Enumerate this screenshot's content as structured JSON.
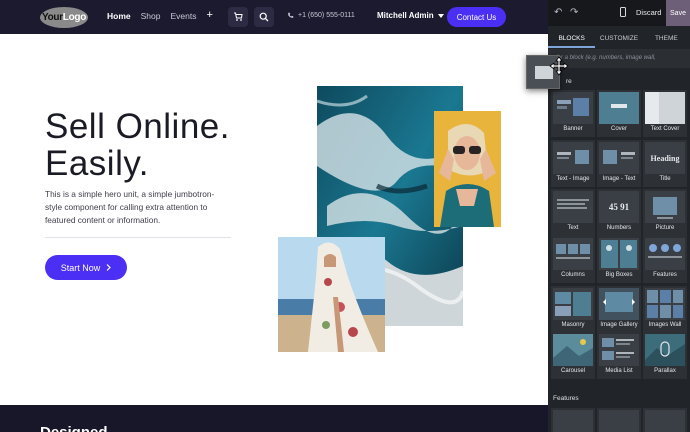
{
  "navbar": {
    "logo_prefix": "Your",
    "logo_suffix": "Logo",
    "links": [
      "Home",
      "Shop",
      "Events"
    ],
    "plus_label": "+",
    "phone": "+1 (650) 555-0111",
    "admin_name": "Mitchell Admin",
    "contact_label": "Contact Us",
    "icons": [
      "cart-icon",
      "search-icon",
      "phone-icon",
      "caret-down-icon"
    ]
  },
  "hero": {
    "title_line1": "Sell Online.",
    "title_line2": "Easily.",
    "description": "This is a simple hero unit, a simple jumbotron-style component for calling extra attention to featured content or information.",
    "cta_label": "Start Now"
  },
  "bottom": {
    "text": "Designed"
  },
  "editor": {
    "discard_label": "Discard",
    "save_label": "Save",
    "tabs": [
      "BLOCKS",
      "CUSTOMIZE",
      "THEME"
    ],
    "active_tab": "BLOCKS",
    "search_placeholder": "for a block (e.g. numbers, image wall,",
    "section_structure": "re",
    "section_features": "Features",
    "blocks": [
      {
        "label": "Banner"
      },
      {
        "label": "Cover"
      },
      {
        "label": "Text Cover"
      },
      {
        "label": "Text - Image"
      },
      {
        "label": "Image - Text"
      },
      {
        "label": "Title",
        "thumb_text": "Heading"
      },
      {
        "label": "Text"
      },
      {
        "label": "Numbers",
        "thumb_text": "45 91"
      },
      {
        "label": "Picture"
      },
      {
        "label": "Columns"
      },
      {
        "label": "Big Boxes"
      },
      {
        "label": "Features"
      },
      {
        "label": "Masonry"
      },
      {
        "label": "Image Gallery"
      },
      {
        "label": "Images Wall"
      },
      {
        "label": "Carousel"
      },
      {
        "label": "Media List"
      },
      {
        "label": "Parallax"
      }
    ]
  },
  "colors": {
    "brand": "#4c2ff5",
    "navbar_bg": "#1c1a2e",
    "panel_bg": "#212529",
    "save_bg": "#6d5f78"
  }
}
